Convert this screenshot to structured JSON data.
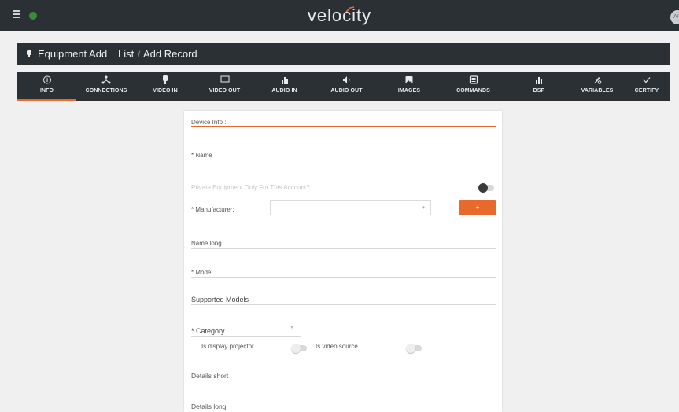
{
  "topbar": {
    "brand": "velocity",
    "avatar_text": "A/",
    "icons": [
      "menu-icon",
      "globe-icon"
    ]
  },
  "header": {
    "title": "Equipment Add",
    "breadcrumb_list": "List",
    "breadcrumb_sep": "/",
    "breadcrumb_current": "Add Record"
  },
  "tabs": [
    {
      "label": "INFO",
      "icon": "info-icon",
      "active": true
    },
    {
      "label": "CONNECTIONS",
      "icon": "connections-icon"
    },
    {
      "label": "VIDEO IN",
      "icon": "plug-icon"
    },
    {
      "label": "VIDEO OUT",
      "icon": "monitor-icon"
    },
    {
      "label": "AUDIO IN",
      "icon": "bar-chart-icon"
    },
    {
      "label": "AUDIO OUT",
      "icon": "speaker-icon"
    },
    {
      "label": "IMAGES",
      "icon": "image-icon"
    },
    {
      "label": "COMMANDS",
      "icon": "commands-icon"
    },
    {
      "label": "DSP",
      "icon": "bar-chart-icon"
    },
    {
      "label": "VARIABLES",
      "icon": "variables-icon"
    },
    {
      "label": "CERTIFY",
      "icon": "check-icon"
    }
  ],
  "form": {
    "section_title": "Device Info :",
    "name_label": "* Name",
    "private_label": "Private Equipment Only For This Account?",
    "manufacturer_label": "* Manufacturer:",
    "manufacturer_value": "",
    "add_button": "+",
    "name_long_label": "Name long",
    "model_label": "* Model",
    "supported_models_label": "Supported Models",
    "category_label": "* Category",
    "display_projector_label": "Is display projector",
    "video_source_label": "Is video source",
    "details_short_label": "Details short",
    "details_long_label": "Details long"
  },
  "colors": {
    "accent": "#e8692c",
    "dark": "#2b3035",
    "background": "#f0f0f0"
  }
}
